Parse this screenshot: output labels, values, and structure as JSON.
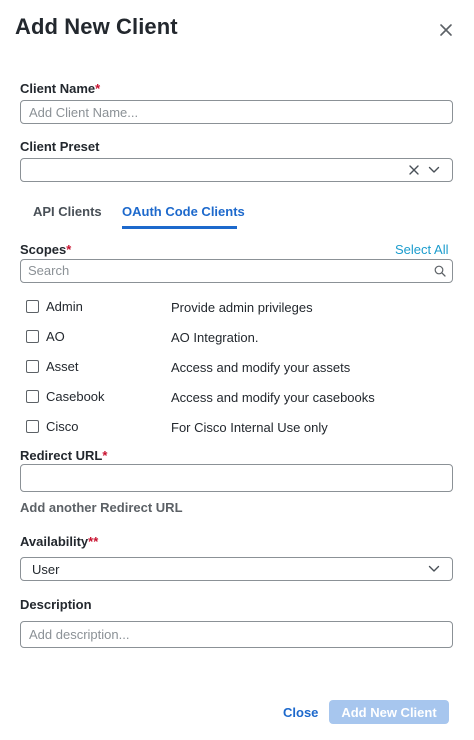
{
  "dialog": {
    "title": "Add New Client"
  },
  "client_name": {
    "label": "Client Name",
    "required_mark": "*",
    "placeholder": "Add Client Name...",
    "value": ""
  },
  "client_preset": {
    "label": "Client Preset",
    "value": ""
  },
  "tabs": [
    {
      "label": "API Clients",
      "active": false
    },
    {
      "label": "OAuth Code Clients",
      "active": true
    }
  ],
  "scopes": {
    "label": "Scopes",
    "required_mark": "*",
    "select_all_label": "Select All",
    "search_placeholder": "Search",
    "items": [
      {
        "name": "Admin",
        "description": "Provide admin privileges",
        "checked": false
      },
      {
        "name": "AO",
        "description": "AO Integration.",
        "checked": false
      },
      {
        "name": "Asset",
        "description": "Access and modify your assets",
        "checked": false
      },
      {
        "name": "Casebook",
        "description": "Access and modify your casebooks",
        "checked": false
      },
      {
        "name": "Cisco",
        "description": "For Cisco Internal Use only",
        "checked": false
      }
    ]
  },
  "redirect_url": {
    "label": "Redirect URL",
    "required_mark": "*",
    "value": "",
    "add_another_label": "Add another Redirect URL"
  },
  "availability": {
    "label": "Availability",
    "required_mark": "**",
    "value": "User"
  },
  "description": {
    "label": "Description",
    "placeholder": "Add description...",
    "value": ""
  },
  "footer": {
    "close_label": "Close",
    "submit_label": "Add New Client"
  },
  "colors": {
    "primary": "#1d69cc",
    "link": "#1b9ccd",
    "required": "#c8102e",
    "disabled_button": "#a7c6ee",
    "border": "#8b9196"
  },
  "icons": {
    "close": "close-icon",
    "clear": "clear-icon",
    "dropdown": "chevron-down-icon",
    "search": "search-icon"
  }
}
